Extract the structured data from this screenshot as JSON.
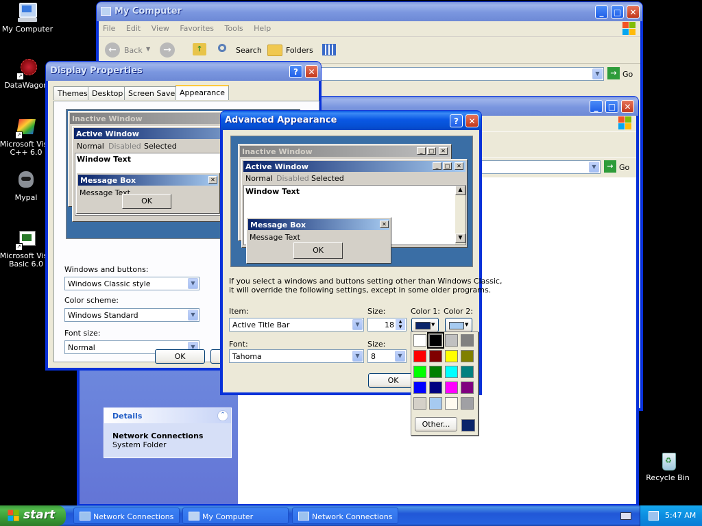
{
  "desktop": {
    "icons": [
      {
        "label": "My Computer",
        "icon": "my-computer-icon"
      },
      {
        "label": "DataWagon.",
        "icon": "shortcut-icon"
      },
      {
        "label": "Microsoft Visu C++ 6.0",
        "icon": "vc6-icon"
      },
      {
        "label": "Mypal",
        "icon": "mypal-icon"
      },
      {
        "label": "Microsoft Visu Basic 6.0",
        "icon": "vb6-icon"
      },
      {
        "label": "Recycle Bin",
        "icon": "recycle-bin-icon"
      }
    ]
  },
  "my_computer_window": {
    "title": "My Computer",
    "menu": [
      "File",
      "Edit",
      "View",
      "Favorites",
      "Tools",
      "Help"
    ],
    "toolbar": {
      "back": "Back",
      "search": "Search",
      "folders": "Folders"
    },
    "go_label": "Go"
  },
  "network_window": {
    "go_label": "Go",
    "details": {
      "header": "Details",
      "title": "Network Connections",
      "subtitle": "System Folder"
    }
  },
  "display_properties": {
    "title": "Display Properties",
    "tabs": [
      "Themes",
      "Desktop",
      "Screen Saver",
      "Appearance"
    ],
    "selected_tab": "Appearance",
    "preview": {
      "inactive_title": "Inactive Window",
      "active_title": "Active Window",
      "menu": [
        "Normal",
        "Disabled",
        "Selected"
      ],
      "window_text": "Window Text",
      "msgbox_title": "Message Box",
      "msgbox_text": "Message Text",
      "ok": "OK"
    },
    "windows_buttons_label": "Windows and buttons:",
    "windows_buttons_value": "Windows Classic style",
    "color_scheme_label": "Color scheme:",
    "color_scheme_value": "Windows Standard",
    "font_size_label": "Font size:",
    "font_size_value": "Normal",
    "ok": "OK"
  },
  "advanced_appearance": {
    "title": "Advanced Appearance",
    "preview": {
      "inactive_title": "Inactive Window",
      "active_title": "Active Window",
      "menu": [
        "Normal",
        "Disabled",
        "Selected"
      ],
      "window_text": "Window Text",
      "msgbox_title": "Message Box",
      "msgbox_text": "Message Text",
      "ok": "OK"
    },
    "info_line1": "If you select a windows and buttons setting other than Windows Classic,",
    "info_line2": "it will override the following settings, except in some older programs.",
    "item_label": "Item:",
    "item_value": "Active Title Bar",
    "size_label": "Size:",
    "size_value": "18",
    "color1_label": "Color 1:",
    "color2_label": "Color 2:",
    "color1": "#0a246a",
    "color2": "#a6caf0",
    "font_label": "Font:",
    "font_value": "Tahoma",
    "font_size_label": "Size:",
    "font_size_value": "8",
    "ok": "OK"
  },
  "palette": {
    "colors": [
      "#ffffff",
      "#000000",
      "#c0c0c0",
      "#808080",
      "#ff0000",
      "#800000",
      "#ffff00",
      "#808000",
      "#00ff00",
      "#008000",
      "#00ffff",
      "#008080",
      "#0000ff",
      "#000080",
      "#ff00ff",
      "#800080",
      "#d4d0c8",
      "#a6caf0",
      "#fffbf0",
      "#a0a0a4"
    ],
    "selected_index": 1,
    "other_label": "Other...",
    "custom_color": "#0a246a"
  },
  "taskbar": {
    "start": "start",
    "tasks": [
      "Network Connections",
      "My Computer",
      "Network Connections"
    ],
    "clock": "5:47 AM"
  }
}
